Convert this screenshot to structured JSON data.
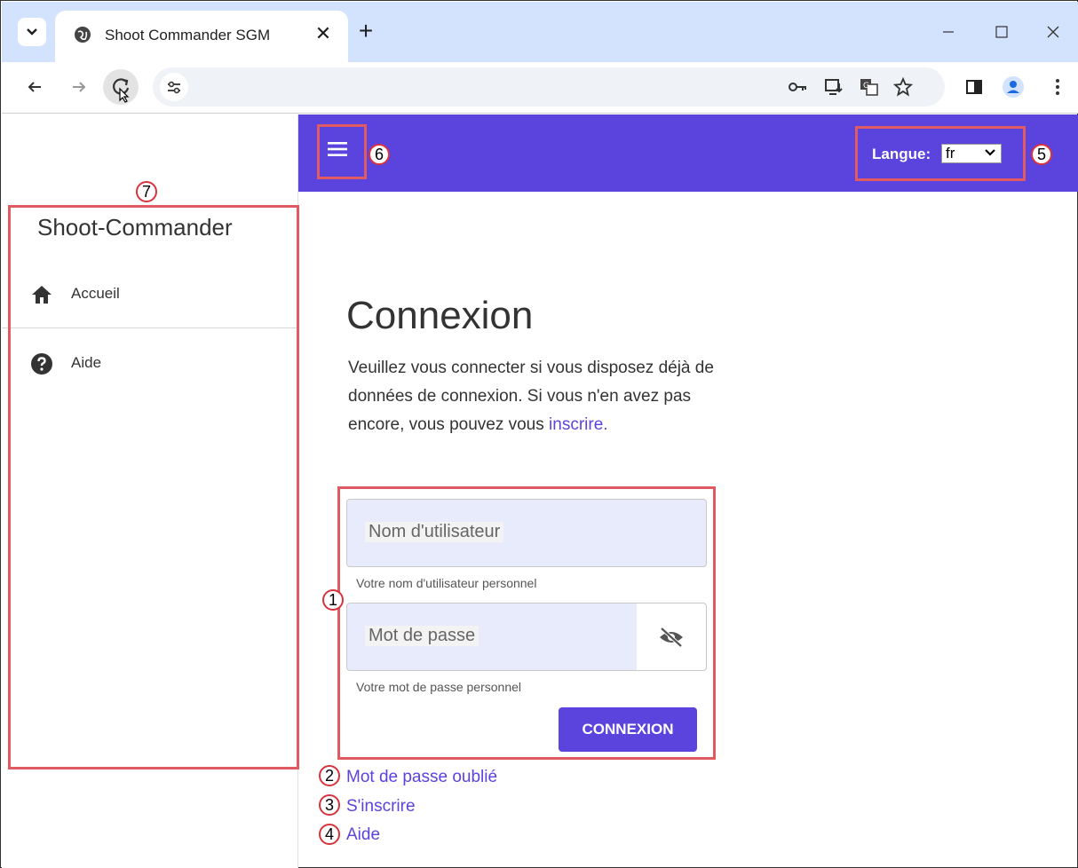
{
  "browser": {
    "tab_title": "Shoot Commander SGM",
    "new_tab_label": "+",
    "tab_close_label": "✕"
  },
  "sidebar": {
    "title": "Shoot-Commander",
    "items": [
      {
        "label": "Accueil",
        "icon": "home-icon"
      },
      {
        "label": "Aide",
        "icon": "help-icon"
      }
    ]
  },
  "header": {
    "language_label": "Langue:",
    "language_value": "fr",
    "accent_color": "#5b43dd"
  },
  "login": {
    "title": "Connexion",
    "intro_text": "Veuillez vous connecter si vous disposez déjà de données de connexion. Si vous n'en avez pas encore, vous pouvez vous ",
    "intro_link": "inscrire.",
    "username_placeholder": "Nom d'utilisateur",
    "username_hint": "Votre nom d'utilisateur personnel",
    "password_placeholder": "Mot de passe",
    "password_hint": "Votre mot de passe personnel",
    "submit_label": "CONNEXION"
  },
  "links": [
    {
      "label": "Mot de passe oublié"
    },
    {
      "label": "S'inscrire"
    },
    {
      "label": "Aide"
    }
  ],
  "annotations": {
    "n1": "1",
    "n2": "2",
    "n3": "3",
    "n4": "4",
    "n5": "5",
    "n6": "6",
    "n7": "7",
    "color": "#e05a62"
  }
}
